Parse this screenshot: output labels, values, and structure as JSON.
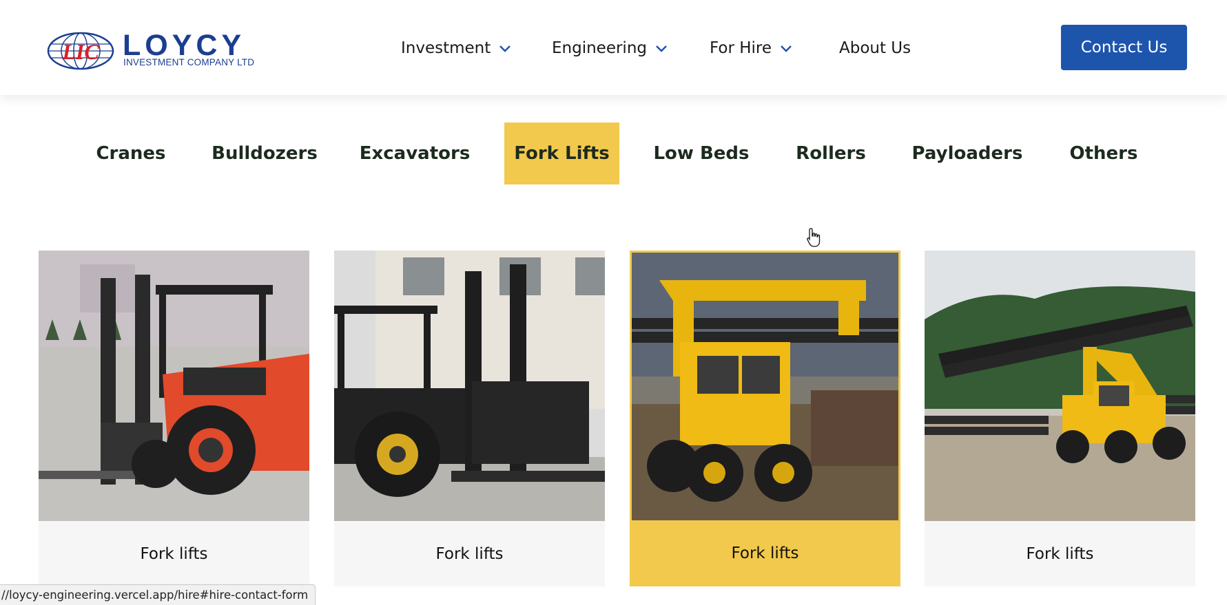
{
  "logo": {
    "mark_text": "LIC",
    "name": "LOYCY",
    "subtitle": "INVESTMENT COMPANY LTD"
  },
  "nav": {
    "items": [
      {
        "label": "Investment",
        "has_dropdown": true,
        "icon": "chevron-down-icon"
      },
      {
        "label": "Engineering",
        "has_dropdown": true,
        "icon": "chevron-down-icon"
      },
      {
        "label": "For Hire",
        "has_dropdown": true,
        "icon": "chevron-down-icon"
      },
      {
        "label": "About Us",
        "has_dropdown": false
      }
    ],
    "contact_label": "Contact Us"
  },
  "categories": {
    "active": "Fork Lifts",
    "items": [
      {
        "label": "Cranes"
      },
      {
        "label": "Bulldozers"
      },
      {
        "label": "Excavators"
      },
      {
        "label": "Fork Lifts"
      },
      {
        "label": "Low Beds"
      },
      {
        "label": "Rollers"
      },
      {
        "label": "Payloaders"
      },
      {
        "label": "Others"
      }
    ]
  },
  "cards": [
    {
      "label": "Fork lifts",
      "image": "red rough-terrain forklift"
    },
    {
      "label": "Fork lifts",
      "image": "black and yellow forklift"
    },
    {
      "label": "Fork lifts",
      "image": "yellow pipe-handling loader",
      "highlighted": true
    },
    {
      "label": "Fork lifts",
      "image": "yellow pipe-handling loader in yard"
    }
  ],
  "status_bar": {
    "url": "//loycy-engineering.vercel.app/hire#hire-contact-form"
  },
  "colors": {
    "brand_blue": "#1b3e91",
    "button_blue": "#1d55ad",
    "accent_yellow": "#f2c94c",
    "card_bg": "#f6f6f6"
  }
}
